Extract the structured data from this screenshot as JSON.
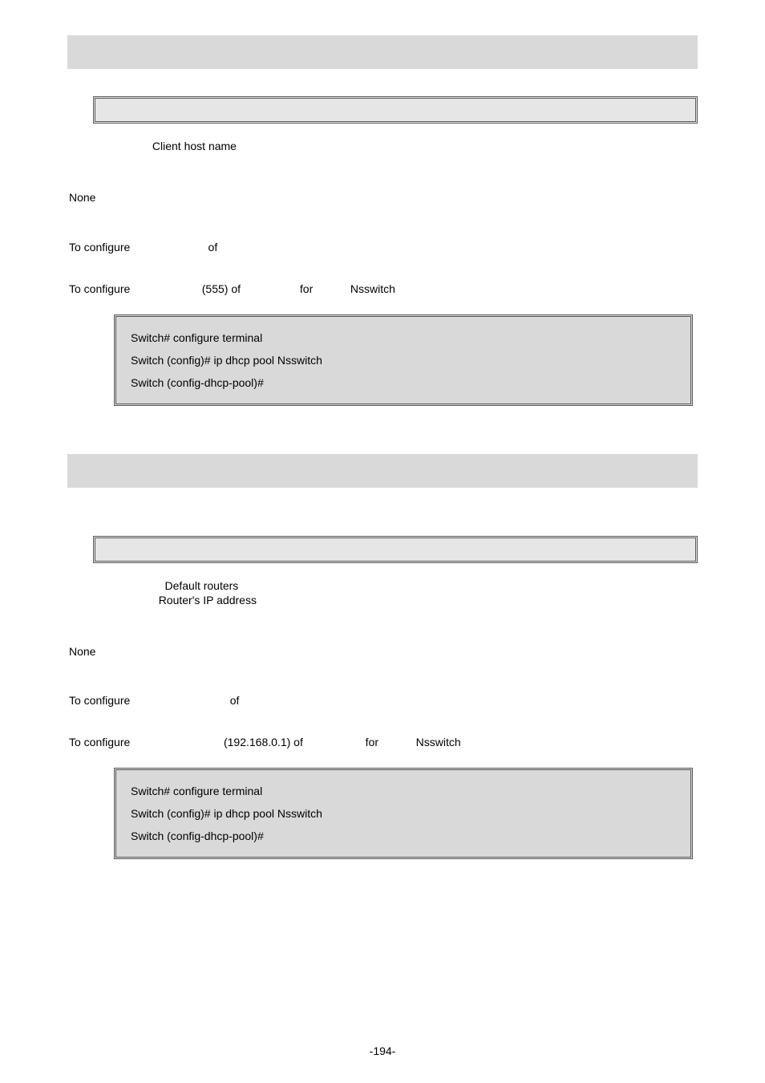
{
  "section1": {
    "param_label": "Client host name",
    "default_value": "None",
    "usage_prefix": "To configure ",
    "usage_mid": " of ",
    "example_prefix": "To configure ",
    "example_mid1": " (555) of ",
    "example_mid2": " for ",
    "example_mid3": " Nsswitch ",
    "code": {
      "l1": "Switch# configure terminal",
      "l2": "Switch (config)# ip dhcp pool Nsswitch",
      "l3": "Switch (config-dhcp-pool)# "
    }
  },
  "section2": {
    "param_label1": "Default routers",
    "param_label2": "Router's IP address",
    "default_value": "None",
    "usage_prefix": "To configure ",
    "usage_mid": " of ",
    "example_prefix": "To configure ",
    "example_mid1": " (192.168.0.1) of ",
    "example_mid2": " for ",
    "example_mid3": " Nsswitch ",
    "code": {
      "l1": "Switch# configure terminal",
      "l2": "Switch (config)# ip dhcp pool Nsswitch",
      "l3": "Switch (config-dhcp-pool)# "
    }
  },
  "page_number": "-194-"
}
